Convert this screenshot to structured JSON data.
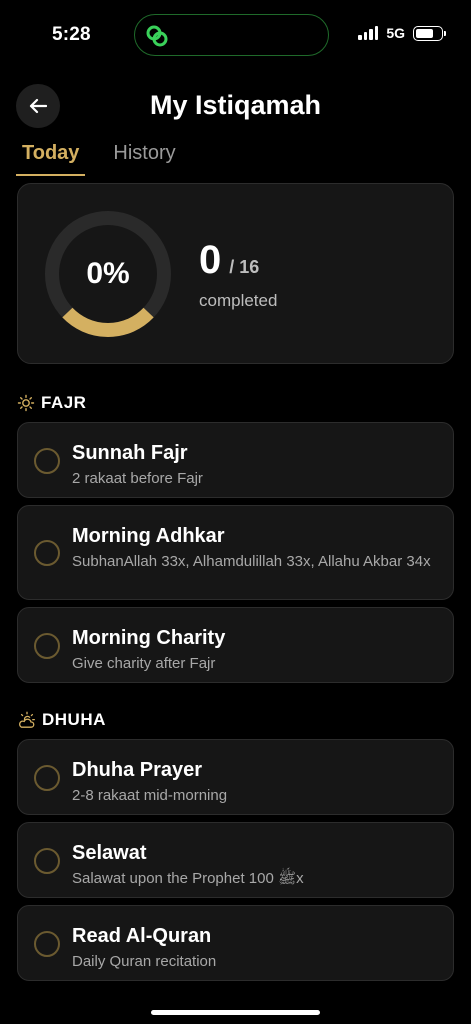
{
  "status": {
    "time": "5:28",
    "network": "5G",
    "battery_level": 0.62,
    "signal_bars": 4
  },
  "header": {
    "title": "My Istiqamah"
  },
  "tabs": [
    {
      "label": "Today",
      "active": true
    },
    {
      "label": "History",
      "active": false
    }
  ],
  "progress": {
    "percent_label": "0%",
    "count": "0",
    "total": "/ 16",
    "completed_label": "completed"
  },
  "colors": {
    "accent": "#d4b061",
    "card": "#161616",
    "ring_track": "#2a2a2a",
    "island_icon": "#3ad15a"
  },
  "sections": [
    {
      "title": "FAJR",
      "icon": "sun-icon",
      "tasks": [
        {
          "title": "Sunnah Fajr",
          "subtitle": "2 rakaat before Fajr",
          "done": false
        },
        {
          "title": "Morning Adhkar",
          "subtitle": "SubhanAllah 33x, Alhamdulillah 33x, Allahu Akbar 34x",
          "done": false
        },
        {
          "title": "Morning Charity",
          "subtitle": "Give charity after Fajr",
          "done": false
        }
      ]
    },
    {
      "title": "DHUHA",
      "icon": "sun-cloud-icon",
      "tasks": [
        {
          "title": "Dhuha Prayer",
          "subtitle": "2-8 rakaat mid-morning",
          "done": false
        },
        {
          "title": "Selawat",
          "subtitle": "Salawat upon the Prophet 100 ﷺx",
          "done": false
        },
        {
          "title": "Read Al-Quran",
          "subtitle": "Daily Quran recitation",
          "done": false
        }
      ]
    }
  ]
}
